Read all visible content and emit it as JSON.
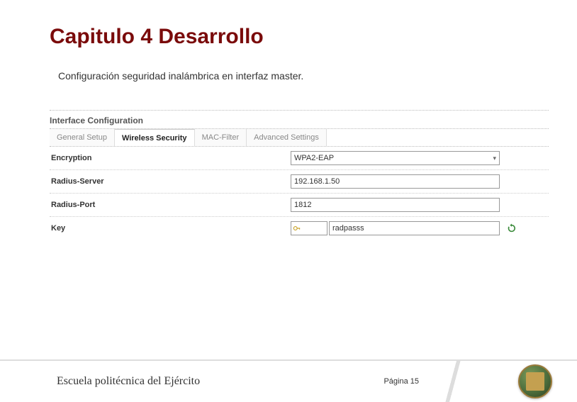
{
  "header": {
    "title": "Capitulo 4  Desarrollo",
    "subtitle": "Configuración seguridad inalámbrica en interfaz master."
  },
  "panel": {
    "section_title": "Interface Configuration",
    "tabs": [
      {
        "label": "General Setup",
        "active": false
      },
      {
        "label": "Wireless Security",
        "active": true
      },
      {
        "label": "MAC-Filter",
        "active": false
      },
      {
        "label": "Advanced Settings",
        "active": false
      }
    ],
    "rows": {
      "encryption": {
        "label": "Encryption",
        "value": "WPA2-EAP"
      },
      "radius_server": {
        "label": "Radius-Server",
        "value": "192.168.1.50"
      },
      "radius_port": {
        "label": "Radius-Port",
        "value": "1812"
      },
      "key": {
        "label": "Key",
        "value": "radpasss"
      }
    }
  },
  "footer": {
    "school": "Escuela politécnica del Ejército",
    "page": "Página 15"
  }
}
